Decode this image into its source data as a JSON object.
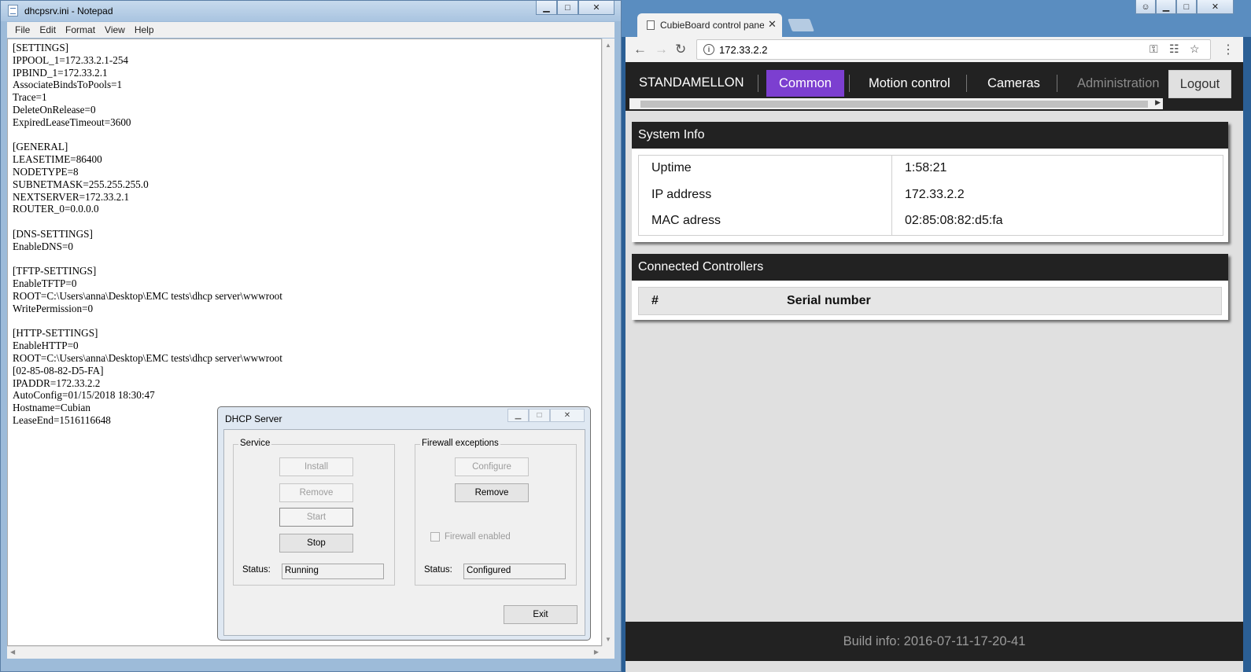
{
  "notepad": {
    "title": "dhcpsrv.ini - Notepad",
    "menu": [
      "File",
      "Edit",
      "Format",
      "View",
      "Help"
    ],
    "content": "[SETTINGS]\nIPPOOL_1=172.33.2.1-254\nIPBIND_1=172.33.2.1\nAssociateBindsToPools=1\nTrace=1\nDeleteOnRelease=0\nExpiredLeaseTimeout=3600\n\n[GENERAL]\nLEASETIME=86400\nNODETYPE=8\nSUBNETMASK=255.255.255.0\nNEXTSERVER=172.33.2.1\nROUTER_0=0.0.0.0\n\n[DNS-SETTINGS]\nEnableDNS=0\n\n[TFTP-SETTINGS]\nEnableTFTP=0\nROOT=C:\\Users\\anna\\Desktop\\EMC tests\\dhcp server\\wwwroot\nWritePermission=0\n\n[HTTP-SETTINGS]\nEnableHTTP=0\nROOT=C:\\Users\\anna\\Desktop\\EMC tests\\dhcp server\\wwwroot\n[02-85-08-82-D5-FA]\nIPADDR=172.33.2.2\nAutoConfig=01/15/2018 18:30:47\nHostname=Cubian\nLeaseEnd=1516116648"
  },
  "dhcp_dialog": {
    "title": "DHCP Server",
    "service": {
      "label": "Service",
      "install": "Install",
      "remove": "Remove",
      "start": "Start",
      "stop": "Stop",
      "status_label": "Status:",
      "status_value": "Running"
    },
    "firewall": {
      "label": "Firewall exceptions",
      "configure": "Configure",
      "remove": "Remove",
      "checkbox_label": "Firewall enabled",
      "status_label": "Status:",
      "status_value": "Configured"
    },
    "exit": "Exit"
  },
  "browser": {
    "tab_title": "CubieBoard control pane",
    "url": "172.33.2.2",
    "navbar": {
      "brand": "STANDAMELLON",
      "items": [
        "Common",
        "Motion control",
        "Cameras",
        "Administration"
      ],
      "logout": "Logout"
    },
    "system_info": {
      "title": "System Info",
      "rows": [
        {
          "label": "Uptime",
          "value": "1:58:21"
        },
        {
          "label": "IP address",
          "value": "172.33.2.2"
        },
        {
          "label": "MAC adress",
          "value": "02:85:08:82:d5:fa"
        }
      ]
    },
    "controllers": {
      "title": "Connected Controllers",
      "col_num": "#",
      "col_serial": "Serial number"
    },
    "footer": "Build info: 2016-07-11-17-20-41"
  },
  "colors": {
    "active_nav": "#7c3fd0",
    "navbar_bg": "#222222",
    "page_bg": "#e0e0e0"
  }
}
